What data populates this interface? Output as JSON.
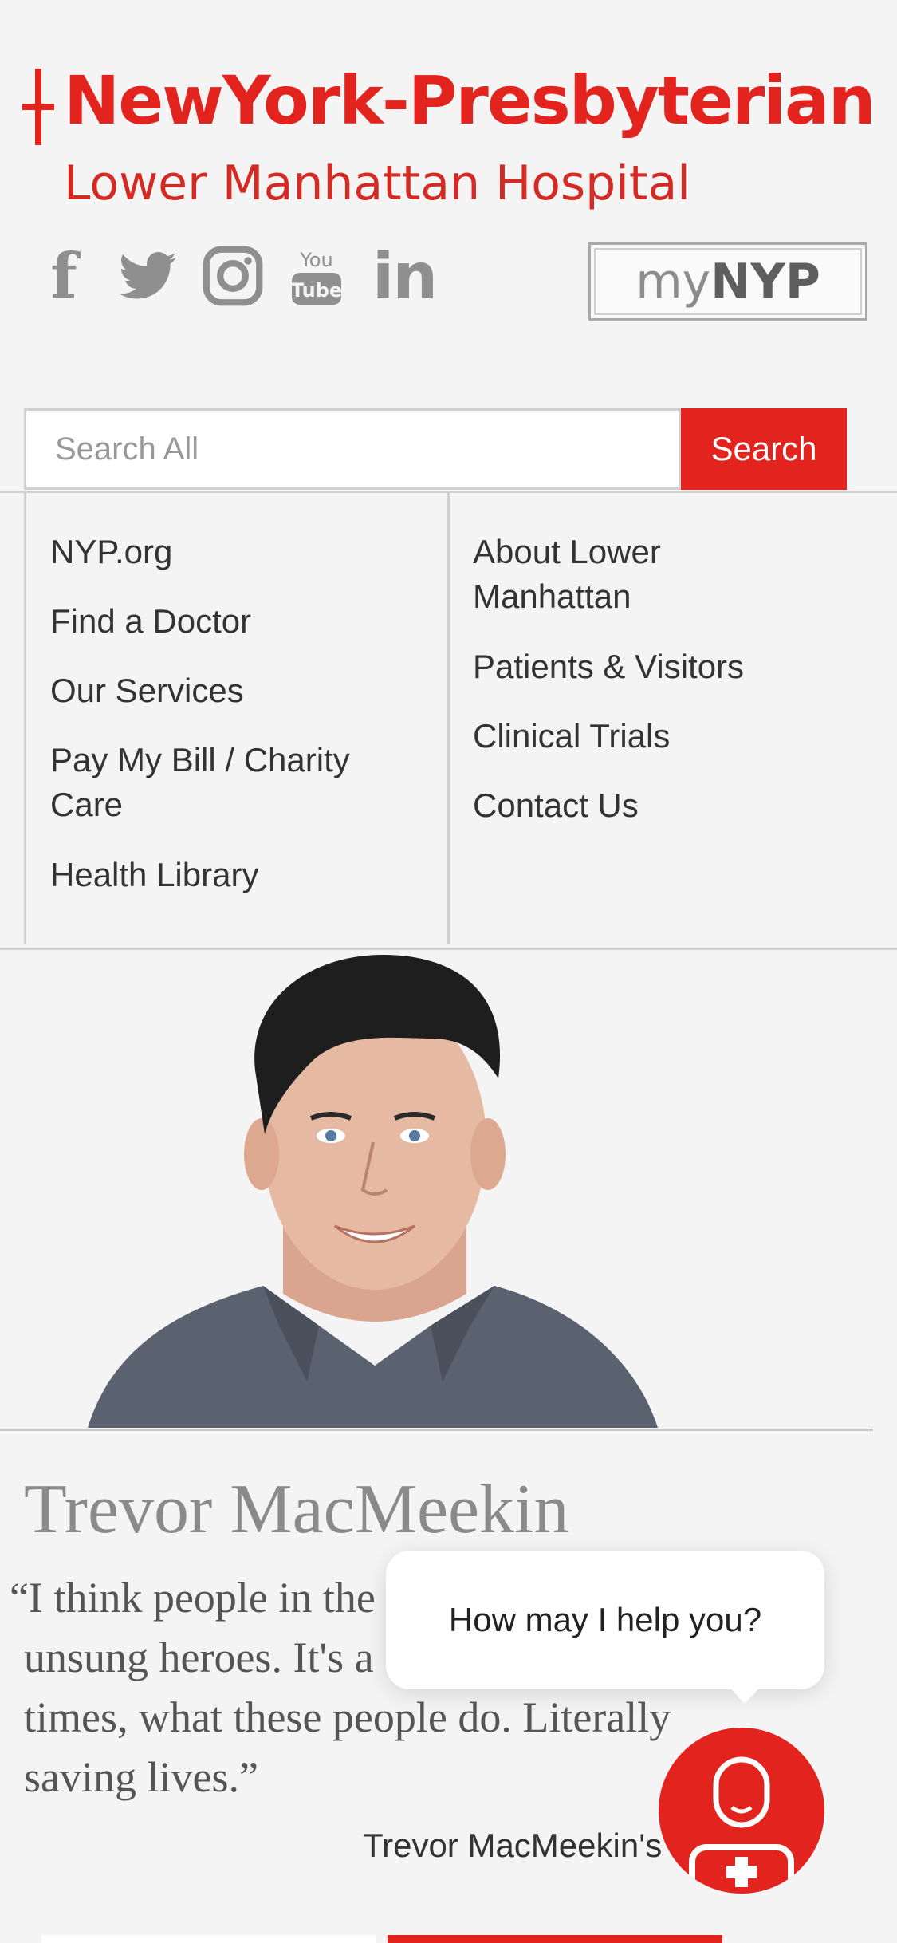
{
  "header": {
    "logo_title": "NewYork-Presbyterian",
    "logo_subtitle": "Lower Manhattan Hospital",
    "social": [
      {
        "icon": "facebook-icon",
        "glyph": "f"
      },
      {
        "icon": "twitter-icon"
      },
      {
        "icon": "instagram-icon"
      },
      {
        "icon": "youtube-icon"
      },
      {
        "icon": "linkedin-icon",
        "glyph": "in"
      }
    ],
    "mynyp": {
      "my": "my",
      "nyp": "NYP"
    }
  },
  "search": {
    "placeholder": "Search All",
    "value": "",
    "button_label": "Search"
  },
  "nav": {
    "left": [
      {
        "line1": "NYP.org"
      },
      {
        "line1": "Find a Doctor"
      },
      {
        "line1": "Our Services"
      },
      {
        "line1": "Pay My Bill / Charity",
        "line2": "Care"
      },
      {
        "line1": "Health Library"
      }
    ],
    "right": [
      {
        "line1": "About Lower",
        "line2": "Manhattan"
      },
      {
        "line1": "Patients & Visitors"
      },
      {
        "line1": "Clinical Trials"
      },
      {
        "line1": "Contact Us"
      }
    ]
  },
  "profile": {
    "name": "Trevor MacMeekin",
    "quote_lines": [
      "“I think people in the",
      "unsung heroes. It's a",
      "times, what these people do. Literally",
      "saving lives.”"
    ],
    "caption": "Trevor MacMeekin's"
  },
  "chat": {
    "prompt": "How may I help you?"
  },
  "colors": {
    "brand_red": "#e3231d",
    "background": "#f4f4f4",
    "icon_gray": "#8f8f8f"
  }
}
